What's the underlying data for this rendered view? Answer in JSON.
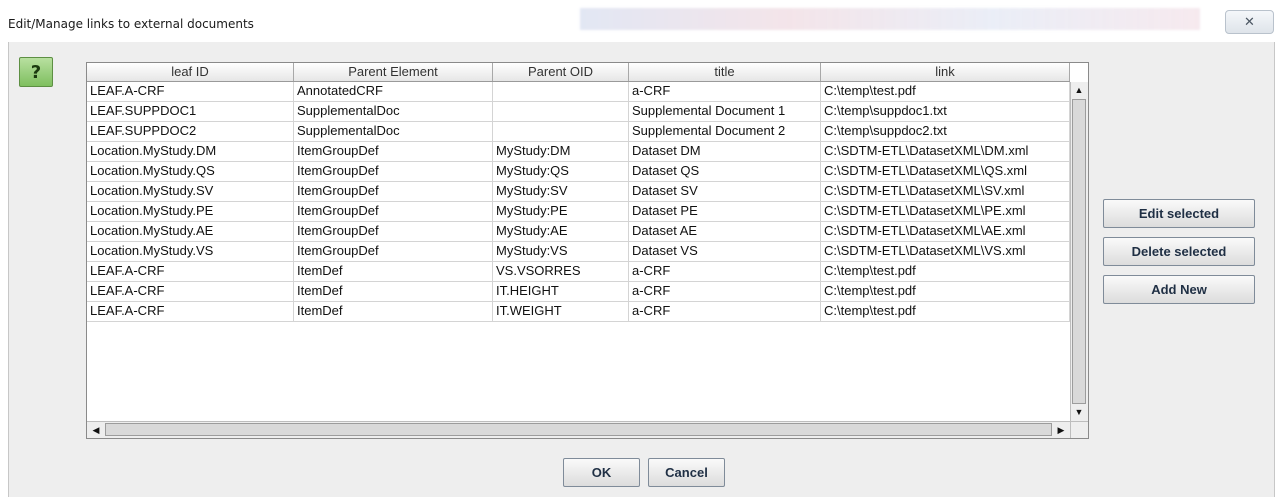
{
  "window": {
    "title": "Edit/Manage links to external documents",
    "close_glyph": "✕"
  },
  "help": {
    "label": "?",
    "icon": "help-icon"
  },
  "table": {
    "columns": [
      "leaf ID",
      "Parent Element",
      "Parent OID",
      "title",
      "link"
    ],
    "rows": [
      [
        "LEAF.A-CRF",
        "AnnotatedCRF",
        "",
        "a-CRF",
        "C:\\temp\\test.pdf"
      ],
      [
        "LEAF.SUPPDOC1",
        "SupplementalDoc",
        "",
        "Supplemental Document 1",
        "C:\\temp\\suppdoc1.txt"
      ],
      [
        "LEAF.SUPPDOC2",
        "SupplementalDoc",
        "",
        "Supplemental Document 2",
        "C:\\temp\\suppdoc2.txt"
      ],
      [
        "Location.MyStudy.DM",
        "ItemGroupDef",
        "MyStudy:DM",
        "Dataset DM",
        "C:\\SDTM-ETL\\DatasetXML\\DM.xml"
      ],
      [
        "Location.MyStudy.QS",
        "ItemGroupDef",
        "MyStudy:QS",
        "Dataset QS",
        "C:\\SDTM-ETL\\DatasetXML\\QS.xml"
      ],
      [
        "Location.MyStudy.SV",
        "ItemGroupDef",
        "MyStudy:SV",
        "Dataset SV",
        "C:\\SDTM-ETL\\DatasetXML\\SV.xml"
      ],
      [
        "Location.MyStudy.PE",
        "ItemGroupDef",
        "MyStudy:PE",
        "Dataset PE",
        "C:\\SDTM-ETL\\DatasetXML\\PE.xml"
      ],
      [
        "Location.MyStudy.AE",
        "ItemGroupDef",
        "MyStudy:AE",
        "Dataset AE",
        "C:\\SDTM-ETL\\DatasetXML\\AE.xml"
      ],
      [
        "Location.MyStudy.VS",
        "ItemGroupDef",
        "MyStudy:VS",
        "Dataset VS",
        "C:\\SDTM-ETL\\DatasetXML\\VS.xml"
      ],
      [
        "LEAF.A-CRF",
        "ItemDef",
        "VS.VSORRES",
        "a-CRF",
        "C:\\temp\\test.pdf"
      ],
      [
        "LEAF.A-CRF",
        "ItemDef",
        "IT.HEIGHT",
        "a-CRF",
        "C:\\temp\\test.pdf"
      ],
      [
        "LEAF.A-CRF",
        "ItemDef",
        "IT.WEIGHT",
        "a-CRF",
        "C:\\temp\\test.pdf"
      ]
    ]
  },
  "actions": {
    "edit": "Edit selected",
    "delete": "Delete selected",
    "add": "Add New"
  },
  "footer": {
    "ok": "OK",
    "cancel": "Cancel"
  },
  "scroll_glyphs": {
    "up": "▲",
    "down": "▼",
    "left": "◀",
    "right": "▶"
  }
}
